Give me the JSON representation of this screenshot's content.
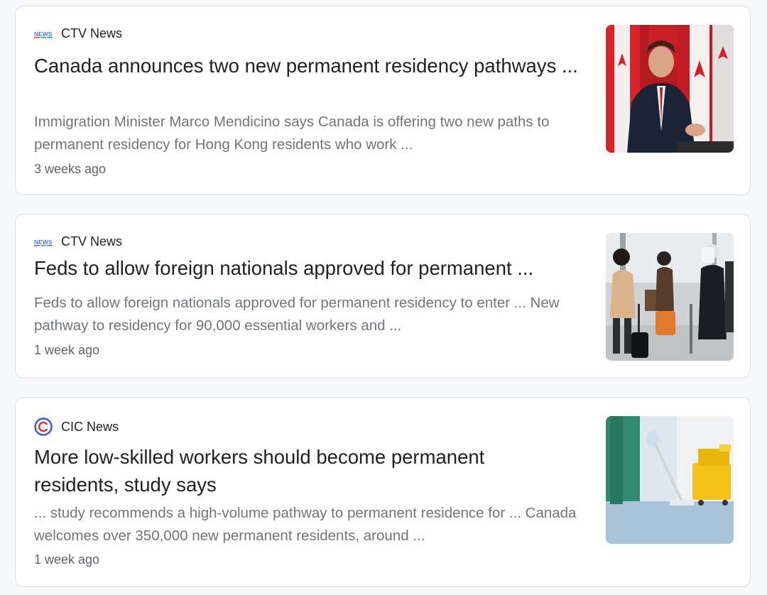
{
  "results": [
    {
      "source": "CTV News",
      "source_icon": "ctv-news-logo-icon",
      "headline": "Canada announces two new permanent residency pathways ...",
      "snippet": "Immigration Minister Marco Mendicino says Canada is offering two new paths to permanent residency for Hong Kong residents who work ...",
      "time": "3 weeks ago",
      "thumbnail": "minister-at-podium-with-canadian-flags"
    },
    {
      "source": "CTV News",
      "source_icon": "ctv-news-logo-icon",
      "headline": "Feds to allow foreign nationals approved for permanent ...",
      "snippet": "Feds to allow foreign nationals approved for permanent residency to enter ... New pathway to residency for 90,000 essential workers and ...",
      "time": "1 week ago",
      "thumbnail": "travellers-with-luggage-at-airport"
    },
    {
      "source": "CIC News",
      "source_icon": "cic-news-logo-icon",
      "headline": "More low-skilled workers should become permanent residents, study says",
      "snippet": "... study recommends a high-volume pathway to permanent residence for ... Canada welcomes over 350,000 new permanent residents, around ...",
      "time": "1 week ago",
      "thumbnail": "worker-mopping-floor-with-yellow-bucket"
    }
  ]
}
